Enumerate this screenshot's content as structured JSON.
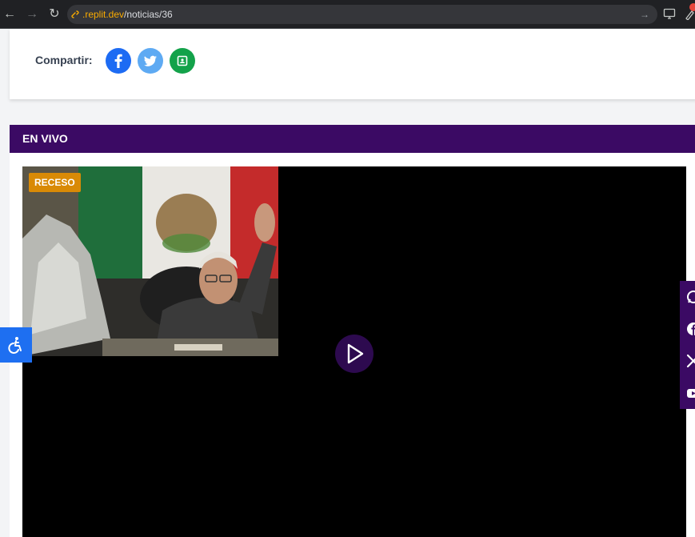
{
  "browser": {
    "url_domain": ".replit.dev",
    "url_path": "/noticias/36",
    "back_glyph": "←",
    "forward_glyph": "→",
    "reload_glyph": "↻",
    "link_glyph": "🔗",
    "go_glyph": "→",
    "screen_glyph": "▭",
    "ext_glyph": "✎"
  },
  "share": {
    "label": "Compartir:",
    "buttons": [
      {
        "name": "facebook",
        "glyph": "f",
        "color": "#1d6bf3"
      },
      {
        "name": "twitter",
        "glyph": "t",
        "color": "#5eaaf3"
      },
      {
        "name": "classroom",
        "glyph": "G",
        "color": "#13a24a"
      }
    ]
  },
  "live": {
    "title": "EN VIVO",
    "status_badge": "RECESO"
  },
  "accessibility": {
    "glyph": "♿"
  },
  "colors": {
    "brand_purple": "#3b0a64",
    "play_button": "#2d0a4f",
    "badge": "#d98a06",
    "accessibility": "#1e6ff1"
  }
}
